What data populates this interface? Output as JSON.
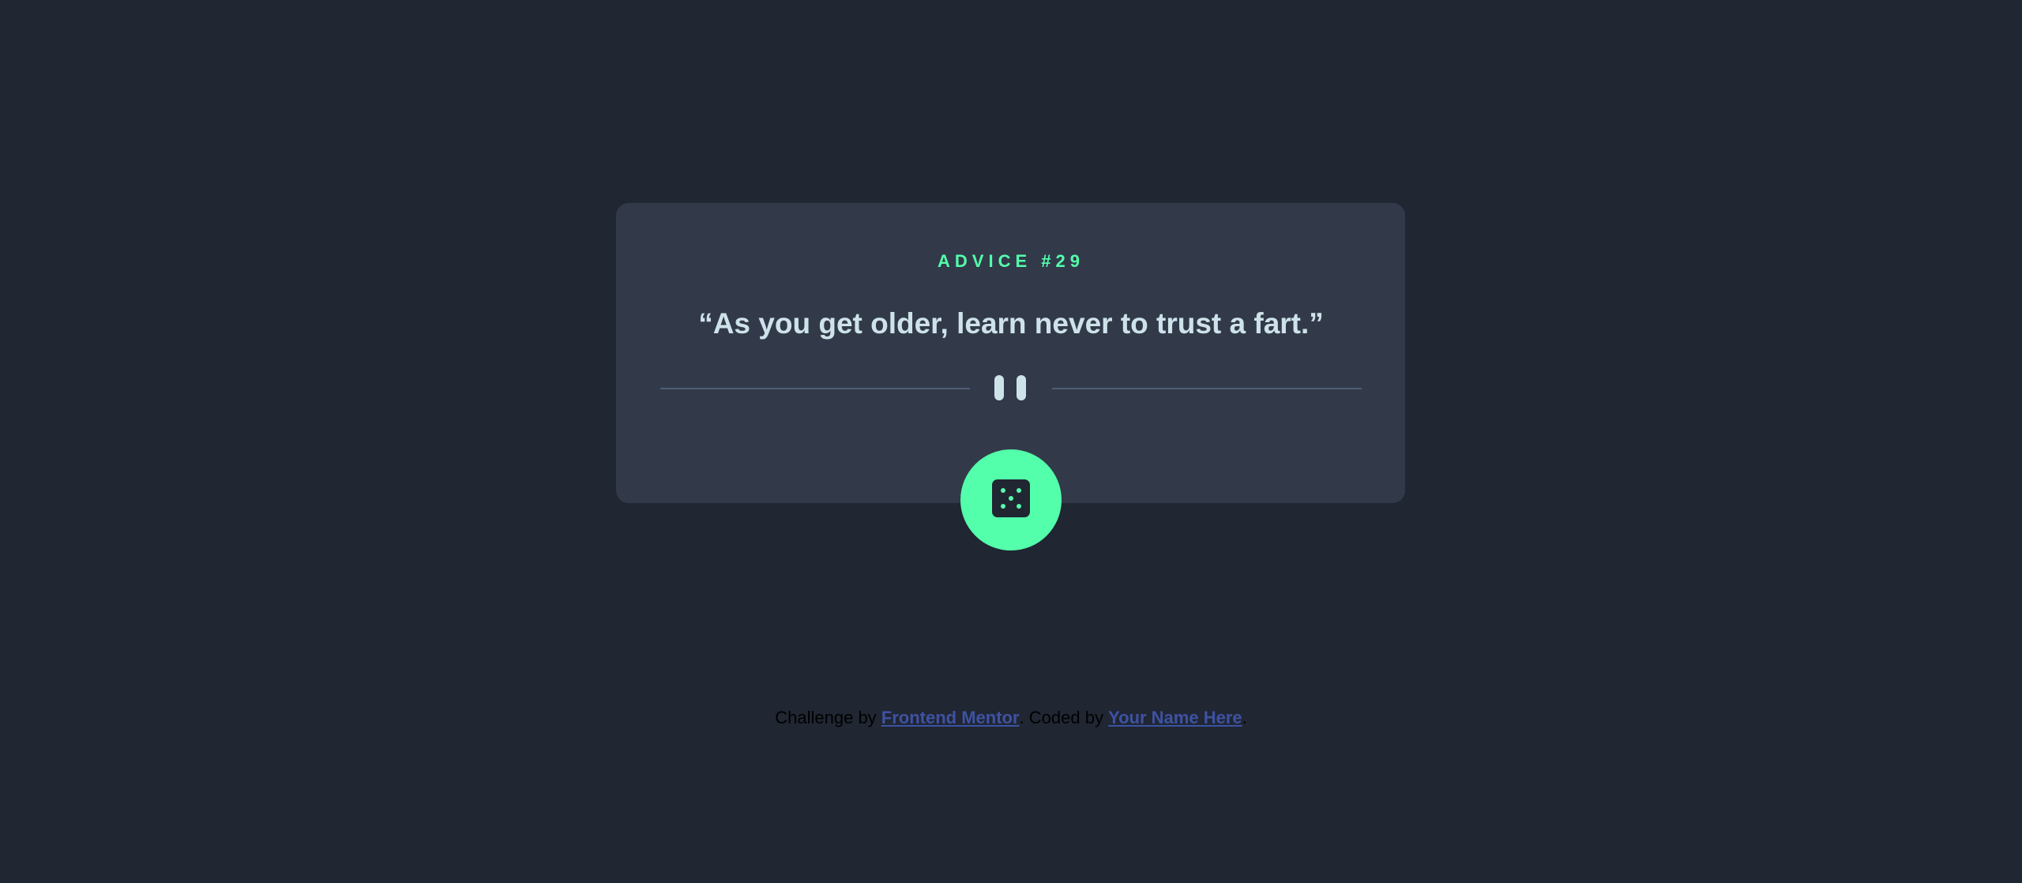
{
  "card": {
    "advice_label": "ADVICE #29",
    "quote": "“As you get older, learn never to trust a fart.”"
  },
  "icons": {
    "divider": "pause-icon",
    "button": "dice-icon"
  },
  "attribution": {
    "prefix": "Challenge by ",
    "link1": "Frontend Mentor",
    "middle": ". Coded by ",
    "link2": "Your Name Here",
    "suffix": "."
  },
  "colors": {
    "background": "#202632",
    "card": "#323a4a",
    "accent": "#53ffab",
    "quote_text": "#cee3e9",
    "divider": "#4f5d74",
    "link": "#3e52a3"
  }
}
